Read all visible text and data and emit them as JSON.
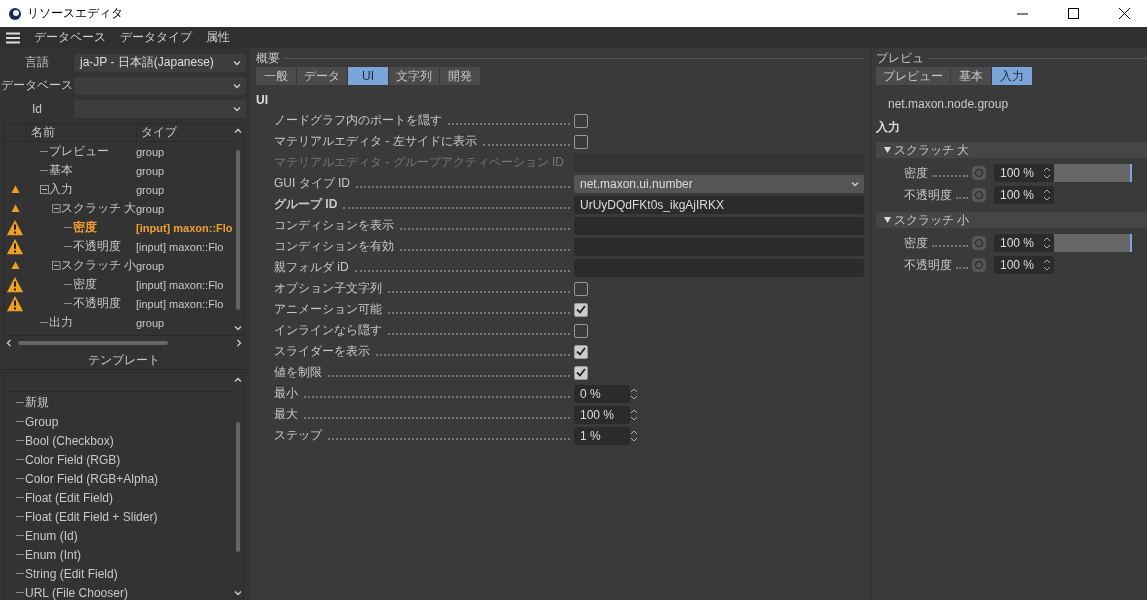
{
  "window": {
    "title": "リソースエディタ"
  },
  "menu": [
    "データベース",
    "データタイプ",
    "属性"
  ],
  "left": {
    "fields": [
      {
        "label": "言語",
        "value": "ja-JP - 日本語(Japanese)"
      },
      {
        "label": "データベース"
      },
      {
        "label": "Id"
      }
    ],
    "tree": {
      "columns": [
        "名前",
        "タイプ"
      ],
      "items": [
        {
          "name": "プレビュー",
          "type": "group",
          "kind": "plain",
          "selected": false
        },
        {
          "name": "基本",
          "type": "group",
          "kind": "plain",
          "selected": false
        },
        {
          "name": "入力",
          "type": "group",
          "kind": "minor",
          "selected": false,
          "expanded": true,
          "children": [
            {
              "name": "スクラッチ 大",
              "type": "group",
              "kind": "minor",
              "selected": false,
              "expanded": true,
              "children": [
                {
                  "name": "密度",
                  "type": "[input] maxon::Flo",
                  "kind": "major",
                  "selected": true
                },
                {
                  "name": "不透明度",
                  "type": "[input] maxon::Flo",
                  "kind": "major",
                  "selected": false
                }
              ]
            },
            {
              "name": "スクラッチ 小",
              "type": "group",
              "kind": "minor",
              "selected": false,
              "expanded": true,
              "children": [
                {
                  "name": "密度",
                  "type": "[input] maxon::Flo",
                  "kind": "major",
                  "selected": false
                },
                {
                  "name": "不透明度",
                  "type": "[input] maxon::Flo",
                  "kind": "major",
                  "selected": false
                }
              ]
            }
          ]
        },
        {
          "name": "出力",
          "type": "group",
          "kind": "plain",
          "selected": false
        }
      ]
    },
    "templates_title": "テンプレート",
    "templates": [
      "新規",
      "Group",
      "Bool (Checkbox)",
      "Color Field (RGB)",
      "Color Field (RGB+Alpha)",
      "Float (Edit Field)",
      "Float (Edit Field + Slider)",
      "Enum (Id)",
      "Enum (Int)",
      "String (Edit Field)",
      "URL (File Chooser)"
    ]
  },
  "overview": {
    "title": "概要",
    "tabs": [
      {
        "label": "一般",
        "selected": false
      },
      {
        "label": "データ",
        "selected": false
      },
      {
        "label": "UI",
        "selected": true
      },
      {
        "label": "文字列",
        "selected": false
      },
      {
        "label": "開発",
        "selected": false
      }
    ],
    "section": "UI",
    "properties": [
      {
        "kind": "checkbox",
        "label": "ノードグラフ内のポートを隠す",
        "checked": false
      },
      {
        "kind": "checkbox",
        "label": "マテリアルエディタ - 左サイドに表示",
        "checked": false
      },
      {
        "kind": "text",
        "label": "マテリアルエディタ - グループアクティベーション ID",
        "disabled": true
      },
      {
        "kind": "dropdown",
        "label": "GUI タイプ ID",
        "value": "net.maxon.ui.number"
      },
      {
        "kind": "text",
        "label": "グループ ID",
        "value": "UrUyDQdFKt0s_ikgAjIRKX",
        "bold": true
      },
      {
        "kind": "text",
        "label": "コンディションを表示"
      },
      {
        "kind": "text",
        "label": "コンディションを有効"
      },
      {
        "kind": "text",
        "label": "親フォルダ iD"
      },
      {
        "kind": "checkbox",
        "label": "オプション子文字列",
        "checked": false
      },
      {
        "kind": "checkbox",
        "label": "アニメーション可能",
        "checked": true
      },
      {
        "kind": "checkbox",
        "label": "インラインなら隠す",
        "checked": false
      },
      {
        "kind": "checkbox",
        "label": "スライダーを表示",
        "checked": true
      },
      {
        "kind": "checkbox",
        "label": "値を制限",
        "checked": true
      },
      {
        "kind": "spinner",
        "label": "最小",
        "value": "0 %"
      },
      {
        "kind": "spinner",
        "label": "最大",
        "value": "100 %"
      },
      {
        "kind": "spinner",
        "label": "ステップ",
        "value": "1 %"
      }
    ]
  },
  "preview": {
    "title": "プレビュ",
    "tabs": [
      {
        "label": "プレビュー",
        "selected": false
      },
      {
        "label": "基本",
        "selected": false
      },
      {
        "label": "入力",
        "selected": true
      }
    ],
    "resource": "net.maxon.node.group",
    "section": "入力",
    "groups": [
      {
        "title": "スクラッチ 大",
        "expanded": true,
        "params": [
          {
            "label": "密度",
            "kind": "slider",
            "value": "100 %",
            "level": 1
          },
          {
            "label": "不透明度",
            "kind": "number",
            "value": "100 %"
          }
        ]
      },
      {
        "title": "スクラッチ 小",
        "expanded": true,
        "params": [
          {
            "label": "密度",
            "kind": "slider",
            "value": "100 %",
            "level": 1
          },
          {
            "label": "不透明度",
            "kind": "number",
            "value": "100 %"
          }
        ]
      }
    ]
  }
}
